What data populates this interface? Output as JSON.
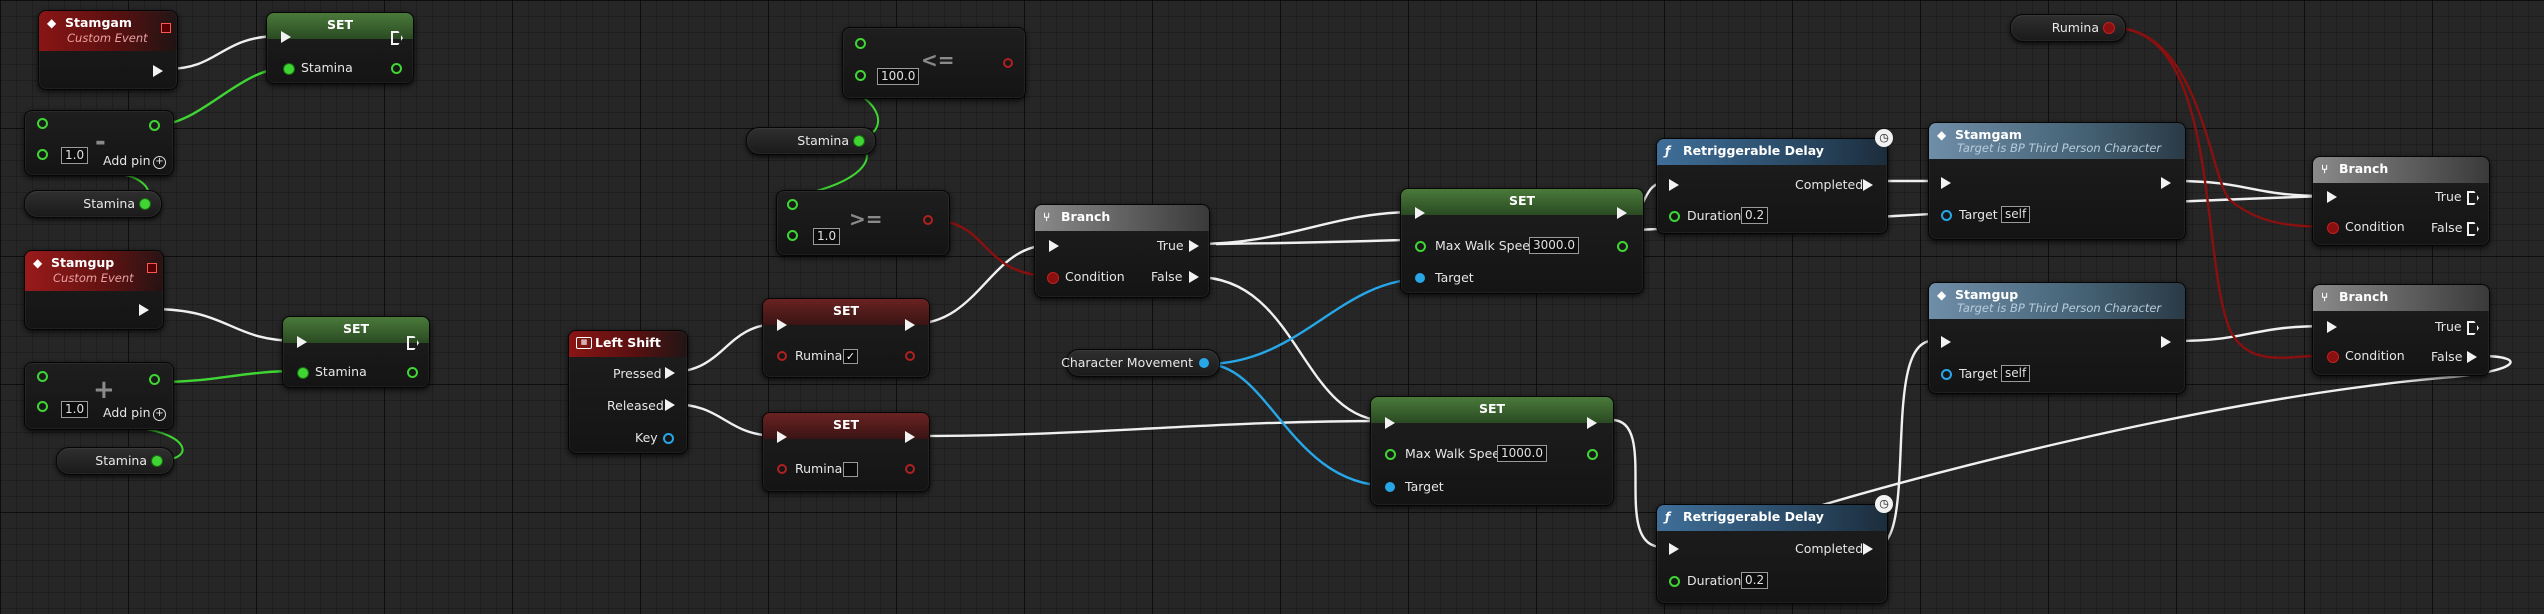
{
  "nodes": {
    "stamgam_event": {
      "title": "Stamgam",
      "subtitle": "Custom Event"
    },
    "stamgup_event": {
      "title": "Stamgup",
      "subtitle": "Custom Event"
    },
    "set_stamina_1": {
      "title": "SET",
      "var": "Stamina"
    },
    "set_stamina_2": {
      "title": "SET",
      "var": "Stamina"
    },
    "subtract": {
      "op": "-",
      "value": "1.0",
      "add_pin": "Add pin"
    },
    "add": {
      "op": "+",
      "value": "1.0",
      "add_pin": "Add pin"
    },
    "get_stamina_1": {
      "label": "Stamina"
    },
    "get_stamina_2": {
      "label": "Stamina"
    },
    "get_stamina_3": {
      "label": "Stamina"
    },
    "lte": {
      "op": "<=",
      "value": "100.0"
    },
    "gte": {
      "op": ">=",
      "value": "1.0"
    },
    "left_shift": {
      "title": "Left Shift",
      "pressed": "Pressed",
      "released": "Released",
      "key": "Key"
    },
    "set_rumina_true": {
      "title": "SET",
      "var": "Rumina",
      "checked": "✓"
    },
    "set_rumina_false": {
      "title": "SET",
      "var": "Rumina"
    },
    "branch_1": {
      "title": "Branch",
      "condition": "Condition",
      "true_label": "True",
      "false_label": "False"
    },
    "branch_2": {
      "title": "Branch",
      "condition": "Condition",
      "true_label": "True",
      "false_label": "False"
    },
    "branch_3": {
      "title": "Branch",
      "condition": "Condition",
      "true_label": "True",
      "false_label": "False"
    },
    "character_movement": {
      "label": "Character Movement"
    },
    "set_walk_3000": {
      "title": "SET",
      "prop": "Max Walk Speed",
      "value": "3000.0",
      "target": "Target"
    },
    "set_walk_1000": {
      "title": "SET",
      "prop": "Max Walk Speed",
      "value": "1000.0",
      "target": "Target"
    },
    "delay_1": {
      "title": "Retriggerable Delay",
      "completed": "Completed",
      "duration": "Duration",
      "value": "0.2"
    },
    "delay_2": {
      "title": "Retriggerable Delay",
      "completed": "Completed",
      "duration": "Duration",
      "value": "0.2"
    },
    "call_stamgam": {
      "title": "Stamgam",
      "subtitle": "Target is BP Third Person Character",
      "target": "Target",
      "target_value": "self"
    },
    "call_stamgup": {
      "title": "Stamgup",
      "subtitle": "Target is BP Third Person Character",
      "target": "Target",
      "target_value": "self"
    },
    "get_rumina": {
      "label": "Rumina"
    }
  },
  "colors": {
    "exec": "#f2f2f2",
    "float": "#3fd633",
    "bool": "#8a0f0f",
    "object": "#27a7e8"
  }
}
